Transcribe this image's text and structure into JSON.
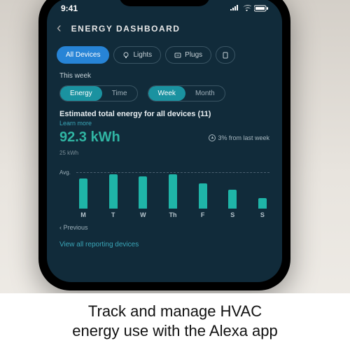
{
  "statusbar": {
    "time": "9:41"
  },
  "header": {
    "title": "ENERGY DASHBOARD"
  },
  "tabs": {
    "all": "All Devices",
    "lights": "Lights",
    "plugs": "Plugs"
  },
  "section": {
    "this_week": "This week",
    "energy": "Energy",
    "time": "Time",
    "week": "Week",
    "month": "Month",
    "est_title": "Estimated total energy for all devices (11)",
    "learn_more": "Learn more",
    "kwh": "92.3 kWh",
    "delta": "3% from last week",
    "ylabel": "25 kWh",
    "avg": "Avg.",
    "prev": "‹ Previous",
    "view_all": "View all reporting devices"
  },
  "chart_data": {
    "type": "bar",
    "categories": [
      "M",
      "T",
      "W",
      "Th",
      "F",
      "S",
      "S"
    ],
    "values": [
      14,
      16,
      15,
      16,
      12,
      9,
      5
    ],
    "title": "Estimated total energy for all devices (11)",
    "xlabel": "",
    "ylabel": "kWh",
    "ylim": [
      0,
      25
    ],
    "avg": 13
  },
  "caption": {
    "line1": "Track and manage HVAC",
    "line2": "energy use with the Alexa app"
  }
}
